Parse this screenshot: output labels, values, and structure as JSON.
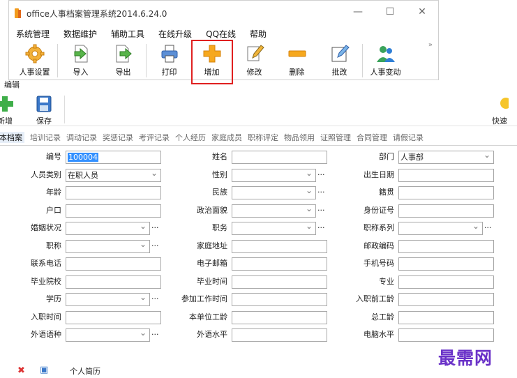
{
  "window": {
    "title": "office人事档案管理系统2014.6.24.0",
    "controls": {
      "minimize": "—",
      "maximize": "☐",
      "close": "✕"
    }
  },
  "menu": [
    "系统管理",
    "数据维护",
    "辅助工具",
    "在线升级",
    "QQ在线",
    "帮助"
  ],
  "toolbar": {
    "items": [
      {
        "label": "人事设置",
        "icon": "gear-icon"
      },
      {
        "label": "导入",
        "icon": "import-icon"
      },
      {
        "label": "导出",
        "icon": "export-icon"
      },
      {
        "label": "打印",
        "icon": "printer-icon"
      },
      {
        "label": "增加",
        "icon": "plus-icon",
        "highlighted": true
      },
      {
        "label": "修改",
        "icon": "edit-icon"
      },
      {
        "label": "删除",
        "icon": "minus-icon"
      },
      {
        "label": "批改",
        "icon": "batch-edit-icon"
      },
      {
        "label": "人事变动",
        "icon": "people-icon"
      }
    ],
    "overflow": "»"
  },
  "subwindow": {
    "title": "编辑",
    "add_label": "新增",
    "save_label": "保存",
    "right_label": "快速"
  },
  "tabs": [
    "基本档案",
    "培训记录",
    "调动记录",
    "奖惩记录",
    "考评记录",
    "个人经历",
    "家庭成员",
    "职称评定",
    "物品领用",
    "证照管理",
    "合同管理",
    "请假记录"
  ],
  "form": {
    "col1": [
      {
        "label": "编号",
        "value": "100004",
        "selected": true
      },
      {
        "label": "人员类别",
        "value": "在职人员",
        "combo": true
      },
      {
        "label": "年龄",
        "value": ""
      },
      {
        "label": "户口",
        "value": ""
      },
      {
        "label": "婚姻状况",
        "value": "",
        "combo": true,
        "dots": true
      },
      {
        "label": "职称",
        "value": "",
        "combo": true,
        "dots": true
      },
      {
        "label": "联系电话",
        "value": ""
      },
      {
        "label": "毕业院校",
        "value": ""
      },
      {
        "label": "学历",
        "value": "",
        "combo": true,
        "dots": true
      },
      {
        "label": "入职时间",
        "value": ""
      },
      {
        "label": "外语语种",
        "value": "",
        "combo": true,
        "dots": true
      }
    ],
    "col2": [
      {
        "label": "姓名",
        "value": ""
      },
      {
        "label": "性别",
        "value": "",
        "combo": true,
        "dots": true
      },
      {
        "label": "民族",
        "value": "",
        "combo": true,
        "dots": true
      },
      {
        "label": "政治面貌",
        "value": "",
        "combo": true,
        "dots": true
      },
      {
        "label": "职务",
        "value": "",
        "combo": true,
        "dots": true
      },
      {
        "label": "家庭地址",
        "value": ""
      },
      {
        "label": "电子邮箱",
        "value": ""
      },
      {
        "label": "毕业时间",
        "value": ""
      },
      {
        "label": "参加工作时间",
        "value": ""
      },
      {
        "label": "本单位工龄",
        "value": ""
      },
      {
        "label": "外语水平",
        "value": ""
      }
    ],
    "col3": [
      {
        "label": "部门",
        "value": "人事部",
        "combo": true
      },
      {
        "label": "出生日期",
        "value": ""
      },
      {
        "label": "籍贯",
        "value": ""
      },
      {
        "label": "身份证号",
        "value": ""
      },
      {
        "label": "职称系列",
        "value": "",
        "combo": true,
        "dots": true
      },
      {
        "label": "邮政编码",
        "value": ""
      },
      {
        "label": "手机号码",
        "value": ""
      },
      {
        "label": "专业",
        "value": ""
      },
      {
        "label": "入职前工龄",
        "value": ""
      },
      {
        "label": "总工龄",
        "value": ""
      },
      {
        "label": "电脑水平",
        "value": ""
      }
    ]
  },
  "bottom": {
    "label": "个人简历"
  },
  "watermark": "最需网",
  "colors": {
    "highlight_border": "#e02020",
    "selection": "#3390ff",
    "watermark": "#6a32c8"
  }
}
